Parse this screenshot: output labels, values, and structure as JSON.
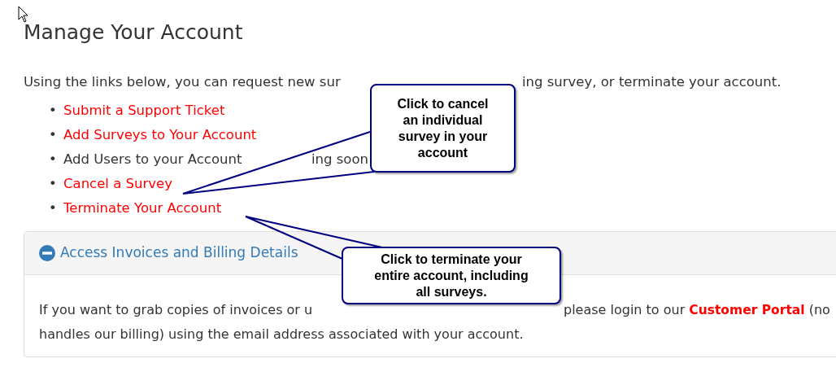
{
  "heading": "Manage Your Account",
  "intro": [
    "Using the links below, you can request new sur",
    "ing survey, or terminate your account."
  ],
  "links": [
    {
      "marker": "•",
      "kind": "link",
      "segments": [
        "Submit a Support Ticket"
      ]
    },
    {
      "marker": "•",
      "kind": "link",
      "segments": [
        "Add Surveys to Your Account"
      ]
    },
    {
      "marker": "•",
      "kind": "plain",
      "segments": [
        "Add Users to your Account",
        "ing soon"
      ]
    },
    {
      "marker": "•",
      "kind": "link",
      "segments": [
        "Cancel a Survey"
      ]
    },
    {
      "marker": "•",
      "kind": "link",
      "segments": [
        "Terminate Your Account"
      ]
    }
  ],
  "panel": {
    "title": "Access Invoices and Billing Details",
    "expanded": true,
    "lines": [
      [
        {
          "kind": "text",
          "text": "If you want to grab copies of invoices or u"
        },
        {
          "kind": "text",
          "text": "please login to our "
        },
        {
          "kind": "link",
          "text": "Customer Portal"
        },
        {
          "kind": "text",
          "text": " (no"
        }
      ],
      [
        {
          "kind": "text",
          "text": "handles our billing) using the email address associated with your account."
        }
      ]
    ]
  },
  "callouts": [
    {
      "text": "Click to cancel an individual survey in your account"
    },
    {
      "text": "Click to terminate your entire account, including all surveys."
    }
  ]
}
